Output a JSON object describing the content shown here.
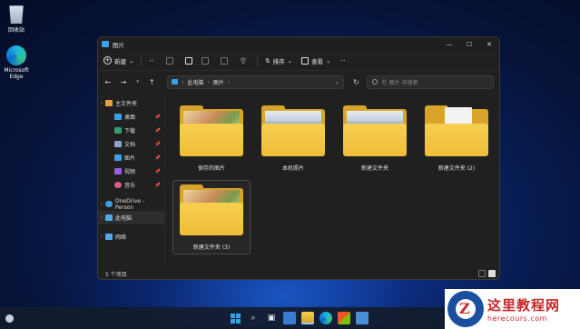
{
  "desktop": {
    "icons": [
      {
        "label": "回收站"
      },
      {
        "label": "Microsoft Edge"
      }
    ]
  },
  "window": {
    "title": "图片",
    "controls": {
      "minimize": "—",
      "maximize": "☐",
      "close": "✕"
    }
  },
  "commandbar": {
    "new_label": "新建",
    "sort_label": "排序",
    "view_label": "查看",
    "more_label": "···"
  },
  "addressbar": {
    "crumbs": [
      "此电脑",
      "图片"
    ],
    "search_placeholder": "在 图片 中搜索"
  },
  "sidebar": {
    "home": "主文件夹",
    "pinned": [
      "桌面",
      "下载",
      "文档",
      "图片",
      "视频",
      "音乐"
    ],
    "onedrive": "OneDrive - Person",
    "this_pc": "此电脑",
    "network": "网络"
  },
  "files": [
    {
      "name": "保存的图片",
      "thumb": "girl"
    },
    {
      "name": "本机照片",
      "thumb": "city"
    },
    {
      "name": "新建文件夹",
      "thumb": "city"
    },
    {
      "name": "新建文件夹 (2)",
      "thumb": "paper"
    },
    {
      "name": "新建文件夹 (3)",
      "thumb": "girl"
    }
  ],
  "status": {
    "item_count": "5 个项目"
  },
  "colors": {
    "folder": "#f7cf4f",
    "accent": "#3aa0e8",
    "watermark": "#c62828"
  },
  "watermark": {
    "cn": "这里教程网",
    "en": "herecours.com"
  }
}
